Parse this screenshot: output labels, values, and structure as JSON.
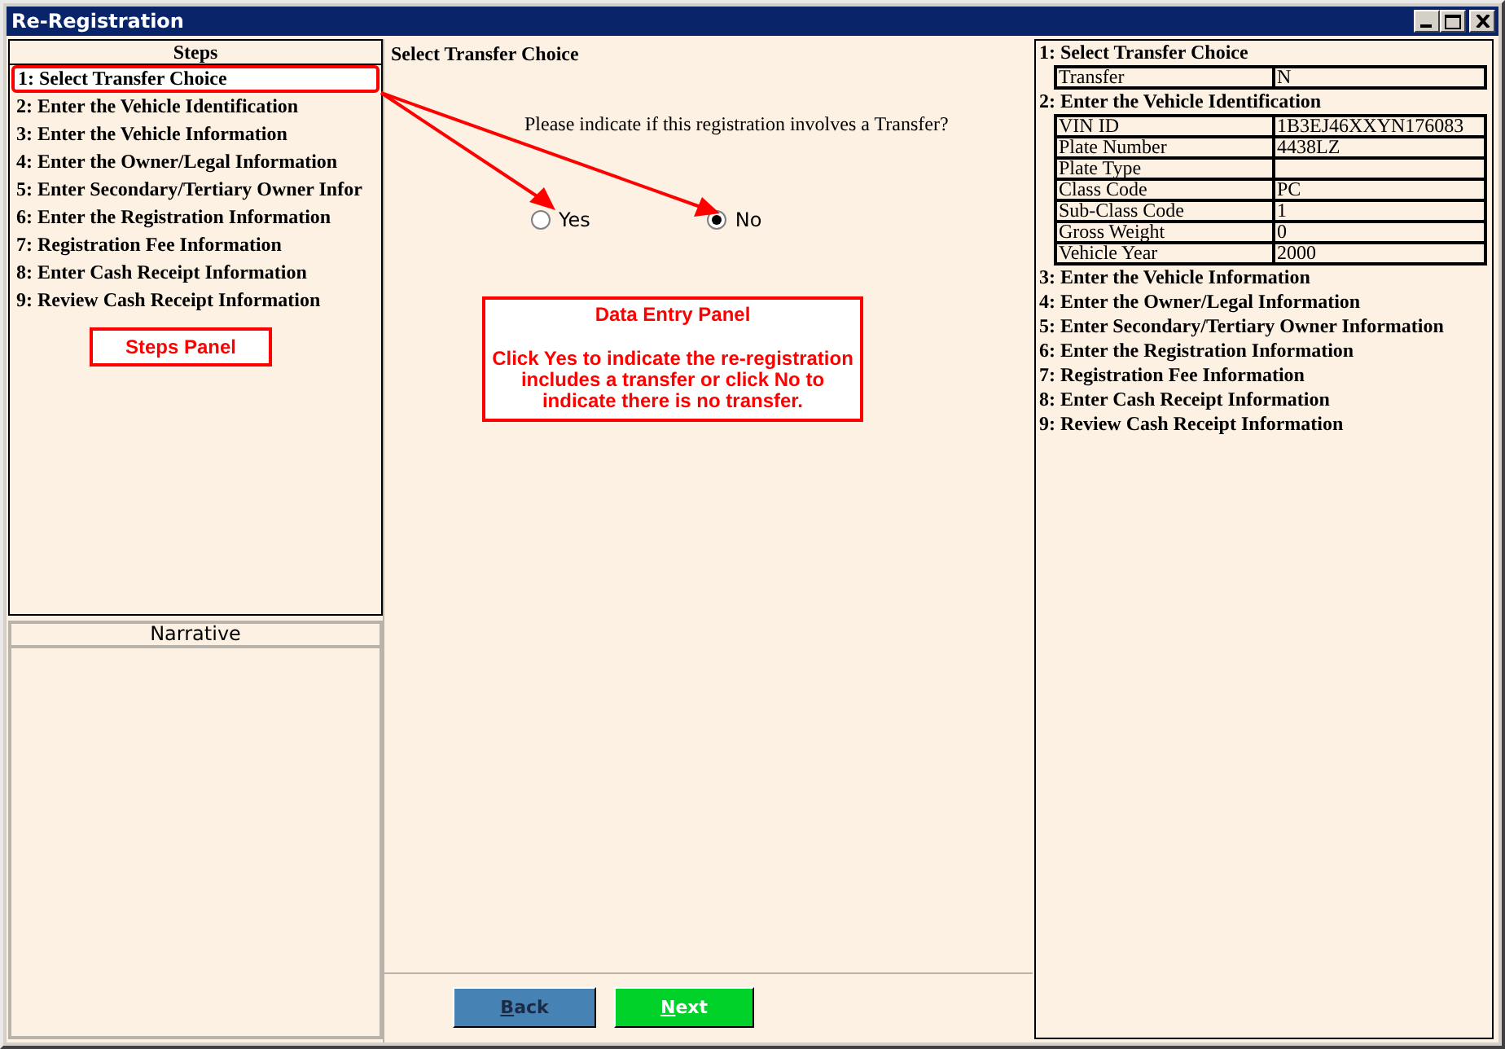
{
  "window": {
    "title": "Re-Registration"
  },
  "steps_panel": {
    "heading": "Steps",
    "items": [
      {
        "label": "1: Select Transfer Choice",
        "selected": true
      },
      {
        "label": "2: Enter the Vehicle Identification",
        "selected": false
      },
      {
        "label": "3: Enter the Vehicle Information",
        "selected": false
      },
      {
        "label": "4: Enter the Owner/Legal Information",
        "selected": false
      },
      {
        "label": "5: Enter  Secondary/Tertiary  Owner Infor",
        "selected": false
      },
      {
        "label": "6: Enter the Registration Information",
        "selected": false
      },
      {
        "label": "7: Registration Fee Information",
        "selected": false
      },
      {
        "label": "8: Enter Cash Receipt Information",
        "selected": false
      },
      {
        "label": "9: Review Cash Receipt Information",
        "selected": false
      }
    ],
    "callout": "Steps Panel"
  },
  "narrative": {
    "heading": "Narrative"
  },
  "data_entry": {
    "heading": "Select Transfer Choice",
    "question": "Please indicate if this registration involves a Transfer?",
    "options": [
      {
        "label": "Yes",
        "selected": false
      },
      {
        "label": "No",
        "selected": true
      }
    ],
    "callout": {
      "title": "Data Entry Panel",
      "text": "Click Yes to indicate the re-registration includes a transfer or click No to indicate there is no transfer."
    },
    "buttons": [
      {
        "label": "Back",
        "kind": "back"
      },
      {
        "label": "Next",
        "kind": "next"
      }
    ]
  },
  "summary": {
    "sections": [
      {
        "title": "1: Select Transfer Choice",
        "rows": [
          {
            "field": "Transfer",
            "value": "N"
          }
        ]
      },
      {
        "title": "2: Enter the Vehicle Identification",
        "rows": [
          {
            "field": "VIN ID",
            "value": "1B3EJ46XXYN176083"
          },
          {
            "field": "Plate Number",
            "value": "4438LZ"
          },
          {
            "field": "Plate Type"
          },
          {
            "field": "Class Code",
            "value": "PC"
          },
          {
            "field": "Sub-Class Code",
            "value": "1"
          },
          {
            "field": "Gross Weight",
            "value": "0"
          },
          {
            "field": "Vehicle Year",
            "value": "2000"
          }
        ]
      },
      {
        "title": "3: Enter the Vehicle Information"
      },
      {
        "title": "4: Enter the Owner/Legal Information"
      },
      {
        "title": "5: Enter Secondary/Tertiary Owner Information"
      },
      {
        "title": "6: Enter the Registration Information"
      },
      {
        "title": "7: Registration Fee Information"
      },
      {
        "title": "8: Enter Cash Receipt Information"
      },
      {
        "title": "9: Review Cash Receipt Information"
      }
    ]
  }
}
